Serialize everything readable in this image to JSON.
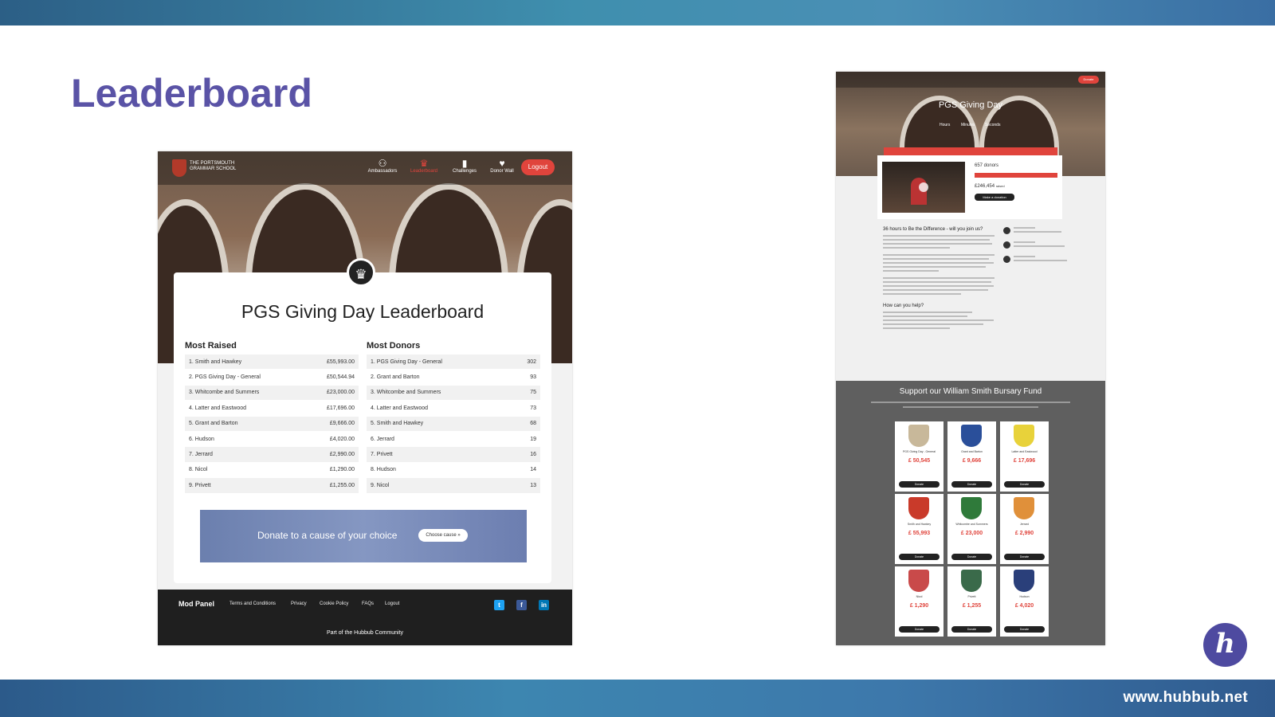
{
  "slide": {
    "title": "Leaderboard",
    "url": "www.hubbub.net",
    "brand_color": "#5a53a6",
    "accent_red": "#e0443c"
  },
  "left_screenshot": {
    "school_name": "THE PORTSMOUTH GRAMMAR SCHOOL",
    "nav": [
      {
        "label": "Ambassadors",
        "icon": "people-icon"
      },
      {
        "label": "Leaderboard",
        "icon": "trophy-icon"
      },
      {
        "label": "Challenges",
        "icon": "bar-chart-icon"
      },
      {
        "label": "Donor Wall",
        "icon": "heart-icon"
      }
    ],
    "logout": "Logout",
    "leaderboard_title": "PGS Giving Day Leaderboard",
    "most_raised_heading": "Most Raised",
    "most_donors_heading": "Most Donors",
    "most_raised": [
      {
        "name": "1. Smith and Hawkey",
        "value": "£55,993.00"
      },
      {
        "name": "2. PGS Giving Day - General",
        "value": "£50,544.94"
      },
      {
        "name": "3. Whitcombe and Summers",
        "value": "£23,000.00"
      },
      {
        "name": "4. Latter and Eastwood",
        "value": "£17,696.00"
      },
      {
        "name": "5. Grant and Barton",
        "value": "£9,666.00"
      },
      {
        "name": "6. Hudson",
        "value": "£4,020.00"
      },
      {
        "name": "7. Jerrard",
        "value": "£2,990.00"
      },
      {
        "name": "8. Nicol",
        "value": "£1,290.00"
      },
      {
        "name": "9. Privett",
        "value": "£1,255.00"
      }
    ],
    "most_donors": [
      {
        "name": "1. PGS Giving Day - General",
        "value": "302"
      },
      {
        "name": "2. Grant and Barton",
        "value": "93"
      },
      {
        "name": "3. Whitcombe and Summers",
        "value": "75"
      },
      {
        "name": "4. Latter and Eastwood",
        "value": "73"
      },
      {
        "name": "5. Smith and Hawkey",
        "value": "68"
      },
      {
        "name": "6. Jerrard",
        "value": "19"
      },
      {
        "name": "7. Privett",
        "value": "16"
      },
      {
        "name": "8. Hudson",
        "value": "14"
      },
      {
        "name": "9. Nicol",
        "value": "13"
      }
    ],
    "donate_banner_text": "Donate to a cause of your choice",
    "choose_cause": "Choose cause »",
    "footer": {
      "mod_panel": "Mod Panel",
      "links": [
        "Terms and Conditions",
        "Privacy",
        "Cookie Policy",
        "FAQs",
        "Logout"
      ],
      "community": "Part of the Hubbub Community"
    }
  },
  "right_screenshot": {
    "title": "PGS Giving Day",
    "countdown_labels": [
      "Hours",
      "Minutes",
      "Seconds"
    ],
    "donate": "Donate",
    "donors": "657 donors",
    "raised": "£246,454",
    "raised_suffix": "raised",
    "make_donation": "Make a donation",
    "body_heading": "36 hours to Be the Difference - will you join us?",
    "help_heading": "How can you help?",
    "fund_title": "Support our William Smith Bursary Fund",
    "tiles": [
      {
        "name": "PGS Giving Day - General",
        "amount": "£ 50,545",
        "color": "#c8b89a"
      },
      {
        "name": "Grant and Barton",
        "amount": "£ 9,666",
        "color": "#2a4f9a"
      },
      {
        "name": "Latter and Eastwood",
        "amount": "£ 17,696",
        "color": "#e8d23a"
      },
      {
        "name": "Smith and Hawkey",
        "amount": "£ 55,993",
        "color": "#c93a2a"
      },
      {
        "name": "Whitcombe and Summers",
        "amount": "£ 23,000",
        "color": "#2f7a3a"
      },
      {
        "name": "Jerrard",
        "amount": "£ 2,990",
        "color": "#e0903a"
      },
      {
        "name": "Nicol",
        "amount": "£ 1,290",
        "color": "#c94a4a"
      },
      {
        "name": "Privett",
        "amount": "£ 1,255",
        "color": "#3a6a4a"
      },
      {
        "name": "Hudson",
        "amount": "£ 4,020",
        "color": "#2a3f7a"
      }
    ],
    "tile_button": "Donate"
  }
}
